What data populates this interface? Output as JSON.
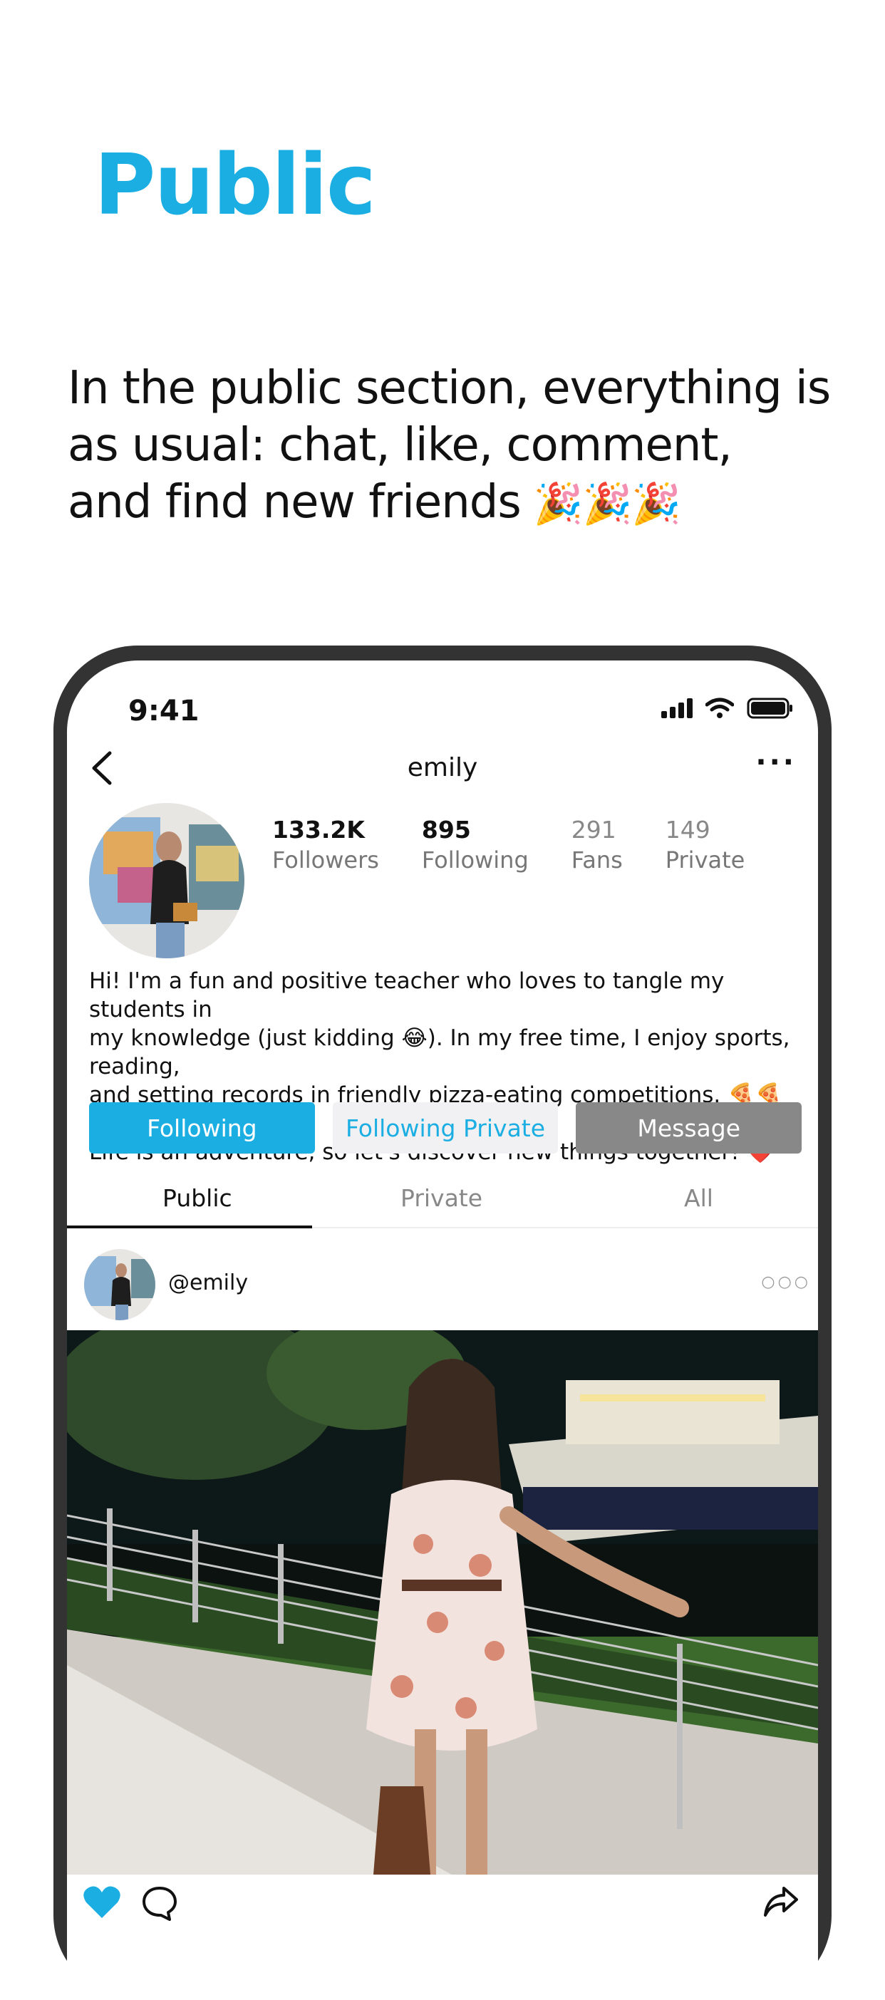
{
  "hero": {
    "title": "Public",
    "line1": "In the public section, everything is",
    "line2": "as usual: chat, like, comment,",
    "line3": "and find new friends",
    "emoji": "🎉🎉🎉"
  },
  "status_bar": {
    "time": "9:41"
  },
  "nav": {
    "title": "emily",
    "more": "···"
  },
  "stats": [
    {
      "value": "133.2K",
      "label": "Followers"
    },
    {
      "value": "895",
      "label": "Following"
    },
    {
      "value": "291",
      "label": "Fans"
    },
    {
      "value": "149",
      "label": "Private"
    }
  ],
  "bio": {
    "line1": "Hi! I'm a fun and positive teacher who loves to tangle my students in",
    "line2": "my knowledge (just kidding 😂). In my free time, I enjoy sports, reading,",
    "line3": "and setting records in friendly pizza-eating competitions. 🍕🍕🍕",
    "line4": "Life is an adventure, so let's discover new things together! ❤️"
  },
  "buttons": {
    "following": "Following",
    "following_private": "Following Private",
    "message": "Message"
  },
  "tabs": [
    {
      "label": "Public"
    },
    {
      "label": "Private"
    },
    {
      "label": "All"
    }
  ],
  "post": {
    "username": "@emily",
    "more": "○○○"
  },
  "colors": {
    "accent": "#1aaee3",
    "gray_button": "#888888",
    "phone_frame": "#333333"
  },
  "icons": [
    "back-arrow-icon",
    "more-icon",
    "signal-icon",
    "wifi-icon",
    "battery-icon",
    "heart-icon",
    "comment-icon",
    "share-icon"
  ]
}
